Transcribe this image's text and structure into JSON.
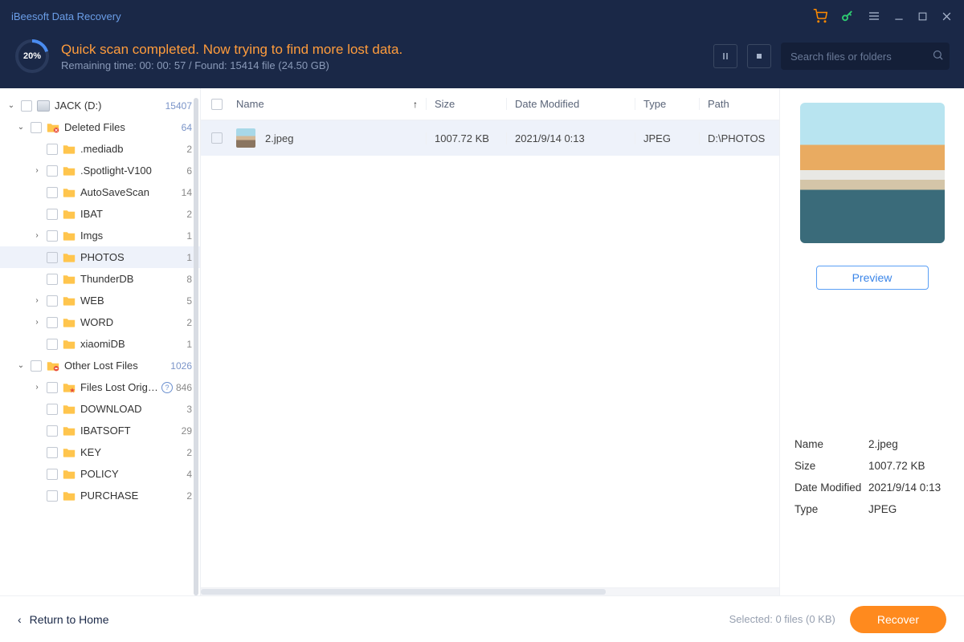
{
  "app": {
    "title": "iBeesoft Data Recovery"
  },
  "header": {
    "progress_pct": "20%",
    "scan_title": "Quick scan completed. Now trying to find more lost data.",
    "scan_subtitle": "Remaining time: 00: 00: 57 / Found: 15414 file (24.50 GB)",
    "search_placeholder": "Search files or folders"
  },
  "tree": {
    "drive": {
      "label": "JACK (D:)",
      "count": "15407"
    },
    "deleted": {
      "label": "Deleted Files",
      "count": "64"
    },
    "items1": [
      {
        "label": ".mediadb",
        "count": "2",
        "caret": ""
      },
      {
        "label": ".Spotlight-V100",
        "count": "6",
        "caret": "›"
      },
      {
        "label": "AutoSaveScan",
        "count": "14",
        "caret": ""
      },
      {
        "label": "IBAT",
        "count": "2",
        "caret": ""
      },
      {
        "label": "Imgs",
        "count": "1",
        "caret": "›"
      },
      {
        "label": "PHOTOS",
        "count": "1",
        "caret": "",
        "selected": true
      },
      {
        "label": "ThunderDB",
        "count": "8",
        "caret": ""
      },
      {
        "label": "WEB",
        "count": "5",
        "caret": "›"
      },
      {
        "label": "WORD",
        "count": "2",
        "caret": "›"
      },
      {
        "label": "xiaomiDB",
        "count": "1",
        "caret": ""
      }
    ],
    "other": {
      "label": "Other Lost Files",
      "count": "1026"
    },
    "lost_original": {
      "label": "Files Lost Origin...",
      "count": "846"
    },
    "items2": [
      {
        "label": "DOWNLOAD",
        "count": "3"
      },
      {
        "label": "IBATSOFT",
        "count": "29"
      },
      {
        "label": "KEY",
        "count": "2"
      },
      {
        "label": "POLICY",
        "count": "4"
      },
      {
        "label": "PURCHASE",
        "count": "2"
      }
    ]
  },
  "columns": {
    "name": "Name",
    "size": "Size",
    "date": "Date Modified",
    "type": "Type",
    "path": "Path"
  },
  "rows": [
    {
      "name": "2.jpeg",
      "size": "1007.72 KB",
      "date": "2021/9/14 0:13",
      "type": "JPEG",
      "path": "D:\\PHOTOS"
    }
  ],
  "preview": {
    "button": "Preview",
    "meta": {
      "name_label": "Name",
      "name": "2.jpeg",
      "size_label": "Size",
      "size": "1007.72 KB",
      "date_label": "Date Modified",
      "date": "2021/9/14 0:13",
      "type_label": "Type",
      "type": "JPEG"
    }
  },
  "footer": {
    "return": "Return to Home",
    "selected": "Selected: 0 files (0 KB)",
    "recover": "Recover"
  }
}
